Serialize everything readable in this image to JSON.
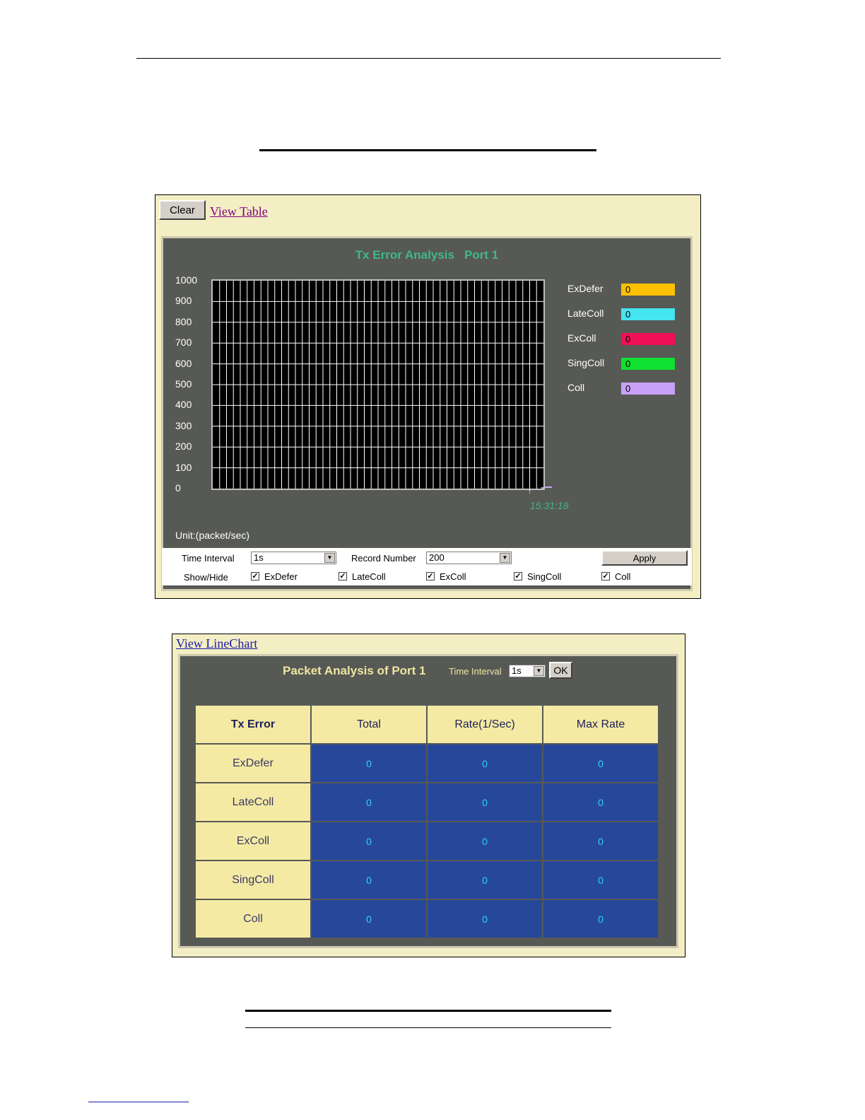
{
  "chart_panel": {
    "clear_label": "Clear",
    "view_table_label": "View Table",
    "unit_label": "Unit:(packet/sec)",
    "time_label": "15:31:18",
    "controls": {
      "time_interval_label": "Time Interval",
      "time_interval_value": "1s",
      "record_number_label": "Record Number",
      "record_number_value": "200",
      "apply_label": "Apply",
      "show_hide_label": "Show/Hide",
      "checkboxes": [
        {
          "label": "ExDefer",
          "checked": true
        },
        {
          "label": "LateColl",
          "checked": true
        },
        {
          "label": "ExColl",
          "checked": true
        },
        {
          "label": "SingColl",
          "checked": true
        },
        {
          "label": "Coll",
          "checked": true
        }
      ]
    }
  },
  "chart_data": {
    "type": "line",
    "title": "Tx Error Analysis   Port 1",
    "ylim": [
      0,
      1000
    ],
    "yticks": [
      "1000",
      "900",
      "800",
      "700",
      "600",
      "500",
      "400",
      "300",
      "200",
      "100",
      "0"
    ],
    "grid": true,
    "legend_position": "right",
    "series": [
      {
        "name": "ExDefer",
        "color": "#ffc000",
        "values": [
          0
        ]
      },
      {
        "name": "LateColl",
        "color": "#44e4f0",
        "values": [
          0
        ]
      },
      {
        "name": "ExColl",
        "color": "#f0105a",
        "values": [
          0
        ]
      },
      {
        "name": "SingColl",
        "color": "#10e030",
        "values": [
          0
        ]
      },
      {
        "name": "Coll",
        "color": "#c8a0f8",
        "values": [
          0
        ]
      }
    ],
    "x": [
      "15:31:18"
    ]
  },
  "table_panel": {
    "view_linechart_label": "View LineChart",
    "title": "Packet Analysis of Port 1",
    "time_interval_label": "Time Interval",
    "time_interval_value": "1s",
    "ok_label": "OK",
    "headers": [
      "Tx Error",
      "Total",
      "Rate(1/Sec)",
      "Max Rate"
    ],
    "rows": [
      {
        "name": "ExDefer",
        "total": "0",
        "rate": "0",
        "max": "0"
      },
      {
        "name": "LateColl",
        "total": "0",
        "rate": "0",
        "max": "0"
      },
      {
        "name": "ExColl",
        "total": "0",
        "rate": "0",
        "max": "0"
      },
      {
        "name": "SingColl",
        "total": "0",
        "rate": "0",
        "max": "0"
      },
      {
        "name": "Coll",
        "total": "0",
        "rate": "0",
        "max": "0"
      }
    ]
  }
}
